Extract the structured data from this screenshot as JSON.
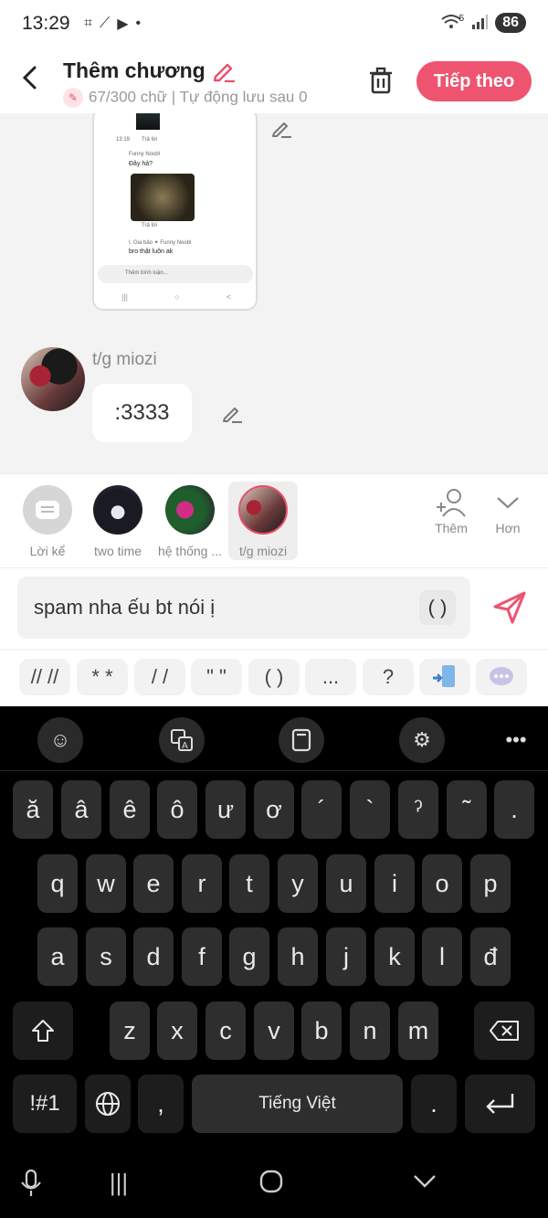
{
  "status_bar": {
    "time": "13:29",
    "battery": "86",
    "wifi_badge": "5"
  },
  "header": {
    "title": "Thêm chương",
    "subtitle": "67/300 chữ | Tự động lưu sau 0",
    "next_button": "Tiếp theo"
  },
  "chat": {
    "screenshot_preview": {
      "user1": "Funny Noobl",
      "msg1": "Đây hả?",
      "reply_label": "Trả lời",
      "user2": "I. Gia bảo ✦ Funny Noobl",
      "msg2": "bro thật luôn ak",
      "input_placeholder": "Thêm bình luận..."
    },
    "author": "t/g miozi",
    "message": ":3333"
  },
  "characters": [
    {
      "label": "Lời kể",
      "selected": false
    },
    {
      "label": "two time",
      "selected": false
    },
    {
      "label": "hệ thống ...",
      "selected": false
    },
    {
      "label": "t/g miozi",
      "selected": true
    }
  ],
  "character_actions": {
    "add_label": "Thêm",
    "more_label": "Hơn"
  },
  "composer": {
    "value": "spam nha ếu bt nói ị",
    "paren_chip": "( )"
  },
  "quick_chips": [
    "// //",
    "* *",
    "/ /",
    "\" \"",
    "( )",
    "...",
    "?"
  ],
  "keyboard": {
    "row0": [
      "ă",
      "â",
      "ê",
      "ô",
      "ư",
      "ơ",
      "´",
      "`",
      "ˀ",
      "˜",
      "."
    ],
    "row1": [
      "q",
      "w",
      "e",
      "r",
      "t",
      "y",
      "u",
      "i",
      "o",
      "p"
    ],
    "row2": [
      "a",
      "s",
      "d",
      "f",
      "g",
      "h",
      "j",
      "k",
      "l",
      "đ"
    ],
    "row3": [
      "z",
      "x",
      "c",
      "v",
      "b",
      "n",
      "m"
    ],
    "symbols_key": "!#1",
    "comma_key": ",",
    "space_label": "Tiếng Việt",
    "period_key": "."
  },
  "colors": {
    "accent": "#ee5470",
    "keyboard_bg": "#000000",
    "key_bg": "#2e2e2e"
  }
}
